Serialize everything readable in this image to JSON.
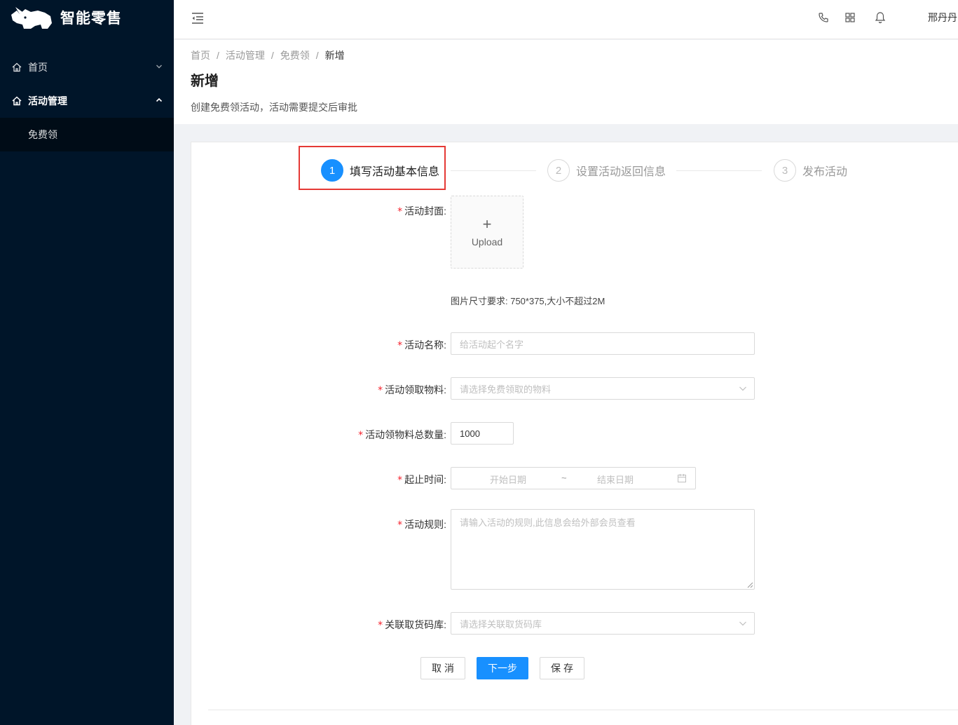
{
  "app": {
    "title": "智能零售"
  },
  "sidebar": {
    "items": [
      {
        "label": "首页",
        "icon": "home-icon",
        "expanded": false
      },
      {
        "label": "活动管理",
        "icon": "home-icon",
        "expanded": true,
        "children": [
          {
            "label": "免费领"
          }
        ]
      }
    ]
  },
  "header": {
    "icons": [
      "menu-fold-icon",
      "phone-icon",
      "appstore-icon",
      "bell-icon"
    ],
    "user": "邢丹丹"
  },
  "breadcrumb": [
    "首页",
    "活动管理",
    "免费领",
    "新增"
  ],
  "page": {
    "title": "新增",
    "description": "创建免费领活动，活动需要提交后审批"
  },
  "steps": [
    {
      "number": "1",
      "label": "填写活动基本信息",
      "status": "active"
    },
    {
      "number": "2",
      "label": "设置活动返回信息",
      "status": "wait"
    },
    {
      "number": "3",
      "label": "发布活动",
      "status": "wait"
    }
  ],
  "form": {
    "cover": {
      "label": "活动封面:",
      "upload_plus": "+",
      "upload_text": "Upload",
      "hint": "图片尺寸要求: 750*375,大小不超过2M"
    },
    "name": {
      "label": "活动名称:",
      "placeholder": "给活动起个名字",
      "value": ""
    },
    "material": {
      "label": "活动领取物料:",
      "placeholder": "请选择免费领取的物料"
    },
    "quantity": {
      "label": "活动领物料总数量:",
      "value": "1000"
    },
    "period": {
      "label": "起止时间:",
      "start_placeholder": "开始日期",
      "separator": "~",
      "end_placeholder": "结束日期"
    },
    "rules": {
      "label": "活动规则:",
      "placeholder": "请输入活动的规则,此信息会给外部会员查看"
    },
    "warehouse": {
      "label": "关联取货码库:",
      "placeholder": "请选择关联取货码库"
    },
    "required_mark": "*"
  },
  "buttons": {
    "cancel": "取消",
    "next": "下一步",
    "save": "保存"
  },
  "colors": {
    "sidebar_bg": "#001529",
    "submenu_bg": "#000c17",
    "primary": "#1890ff",
    "required": "#f5222d",
    "highlight": "#e53935"
  }
}
